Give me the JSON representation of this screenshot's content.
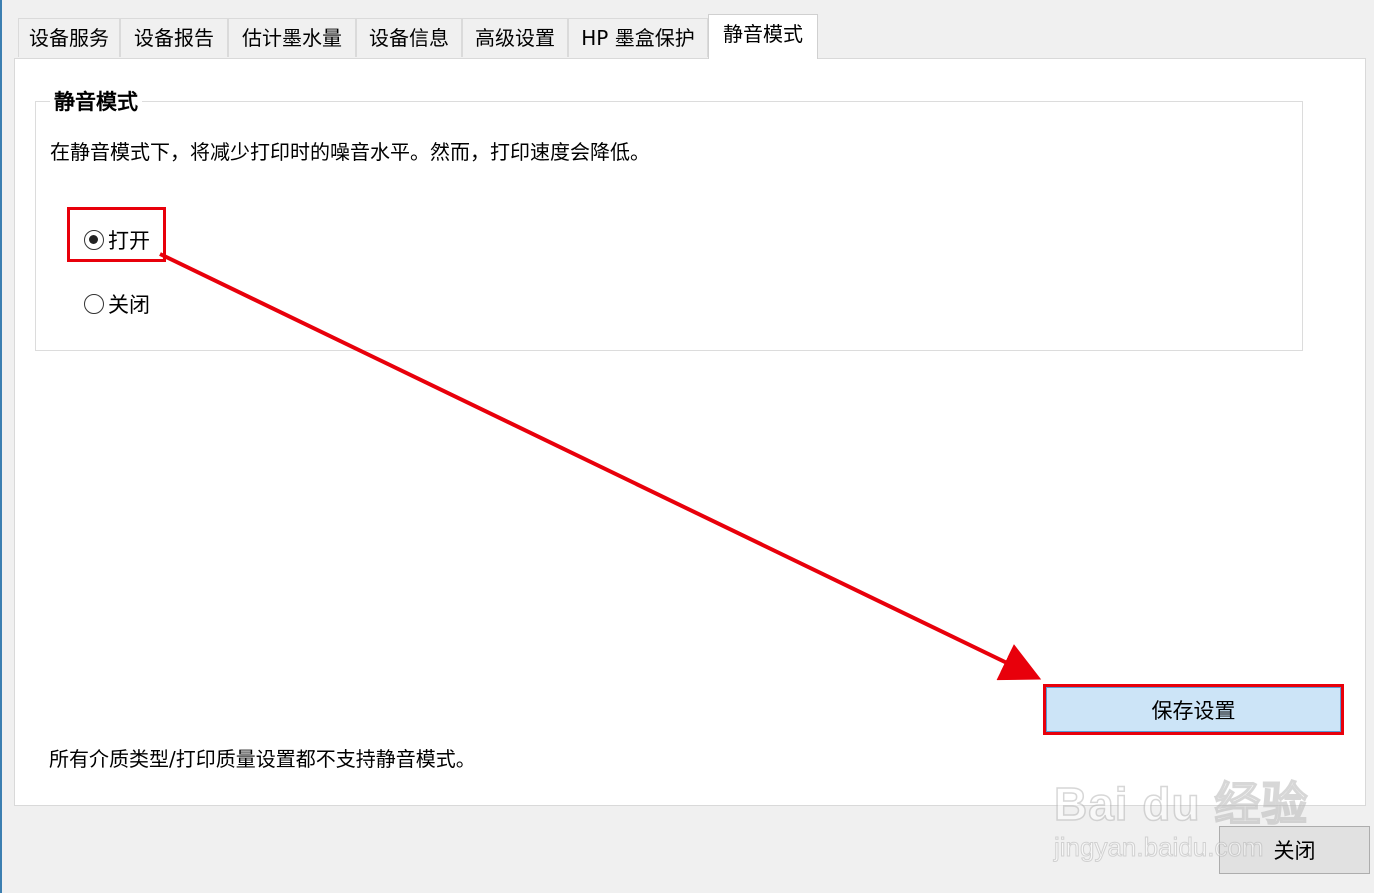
{
  "tabs": [
    {
      "label": "设备服务"
    },
    {
      "label": "设备报告"
    },
    {
      "label": "估计墨水量"
    },
    {
      "label": "设备信息"
    },
    {
      "label": "高级设置"
    },
    {
      "label": "HP 墨盒保护"
    },
    {
      "label": "静音模式",
      "active": true
    }
  ],
  "quiet_mode": {
    "group_title": "静音模式",
    "description": "在静音模式下，将减少打印时的噪音水平。然而，打印速度会降低。",
    "options": [
      {
        "label": "打开",
        "selected": true
      },
      {
        "label": "关闭",
        "selected": false
      }
    ]
  },
  "buttons": {
    "save": "保存设置",
    "close": "关闭"
  },
  "footnote": "所有介质类型/打印质量设置都不支持静音模式。",
  "annotation_color": "#e8000b",
  "watermark": {
    "logo": "Bai du 经验",
    "url": "jingyan.baidu.com"
  }
}
